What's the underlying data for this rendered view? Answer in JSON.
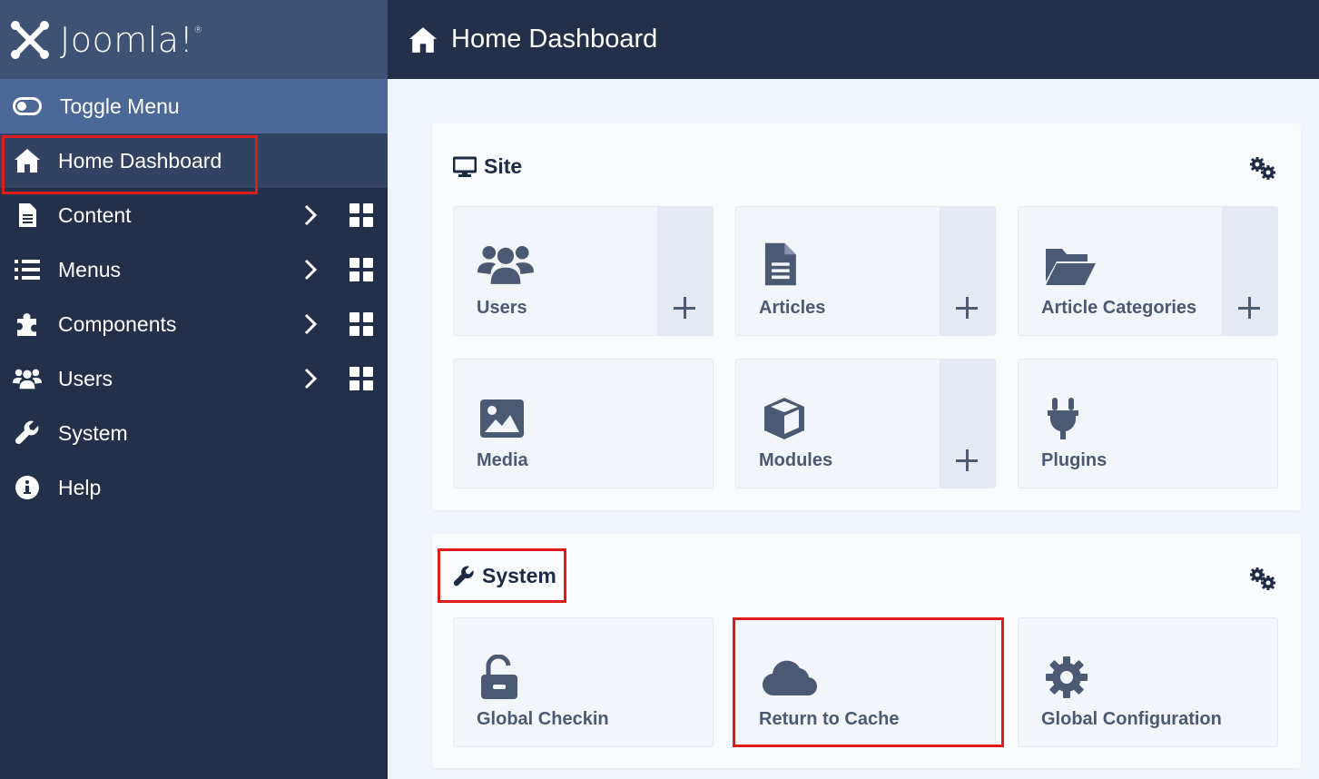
{
  "brand": {
    "name": "Joomla!",
    "mark": "®"
  },
  "sidebar": {
    "toggle_label": "Toggle Menu",
    "items": [
      {
        "label": "Home Dashboard",
        "icon": "home-icon",
        "active": true
      },
      {
        "label": "Content",
        "icon": "file-icon",
        "has_submenu": true
      },
      {
        "label": "Menus",
        "icon": "list-icon",
        "has_submenu": true
      },
      {
        "label": "Components",
        "icon": "puzzle-icon",
        "has_submenu": true
      },
      {
        "label": "Users",
        "icon": "users-icon",
        "has_submenu": true
      },
      {
        "label": "System",
        "icon": "wrench-icon"
      },
      {
        "label": "Help",
        "icon": "info-icon"
      }
    ]
  },
  "header": {
    "title": "Home Dashboard"
  },
  "site_card": {
    "title": "Site",
    "tiles": [
      {
        "label": "Users",
        "icon": "users-icon",
        "addable": true
      },
      {
        "label": "Articles",
        "icon": "file-icon",
        "addable": true
      },
      {
        "label": "Article Categories",
        "icon": "folder-open-icon",
        "addable": true
      },
      {
        "label": "Media",
        "icon": "image-icon",
        "addable": false
      },
      {
        "label": "Modules",
        "icon": "cube-icon",
        "addable": true
      },
      {
        "label": "Plugins",
        "icon": "plug-icon",
        "addable": false
      }
    ]
  },
  "system_card": {
    "title": "System",
    "tiles": [
      {
        "label": "Global Checkin",
        "icon": "unlock-icon"
      },
      {
        "label": "Return to Cache",
        "icon": "cloud-icon"
      },
      {
        "label": "Global Configuration",
        "icon": "cog-icon"
      }
    ]
  },
  "colors": {
    "sidebar_bg": "#223049",
    "accent": "#4b6896",
    "highlight": "#e01b1b",
    "tile_text": "#4a5a72"
  }
}
